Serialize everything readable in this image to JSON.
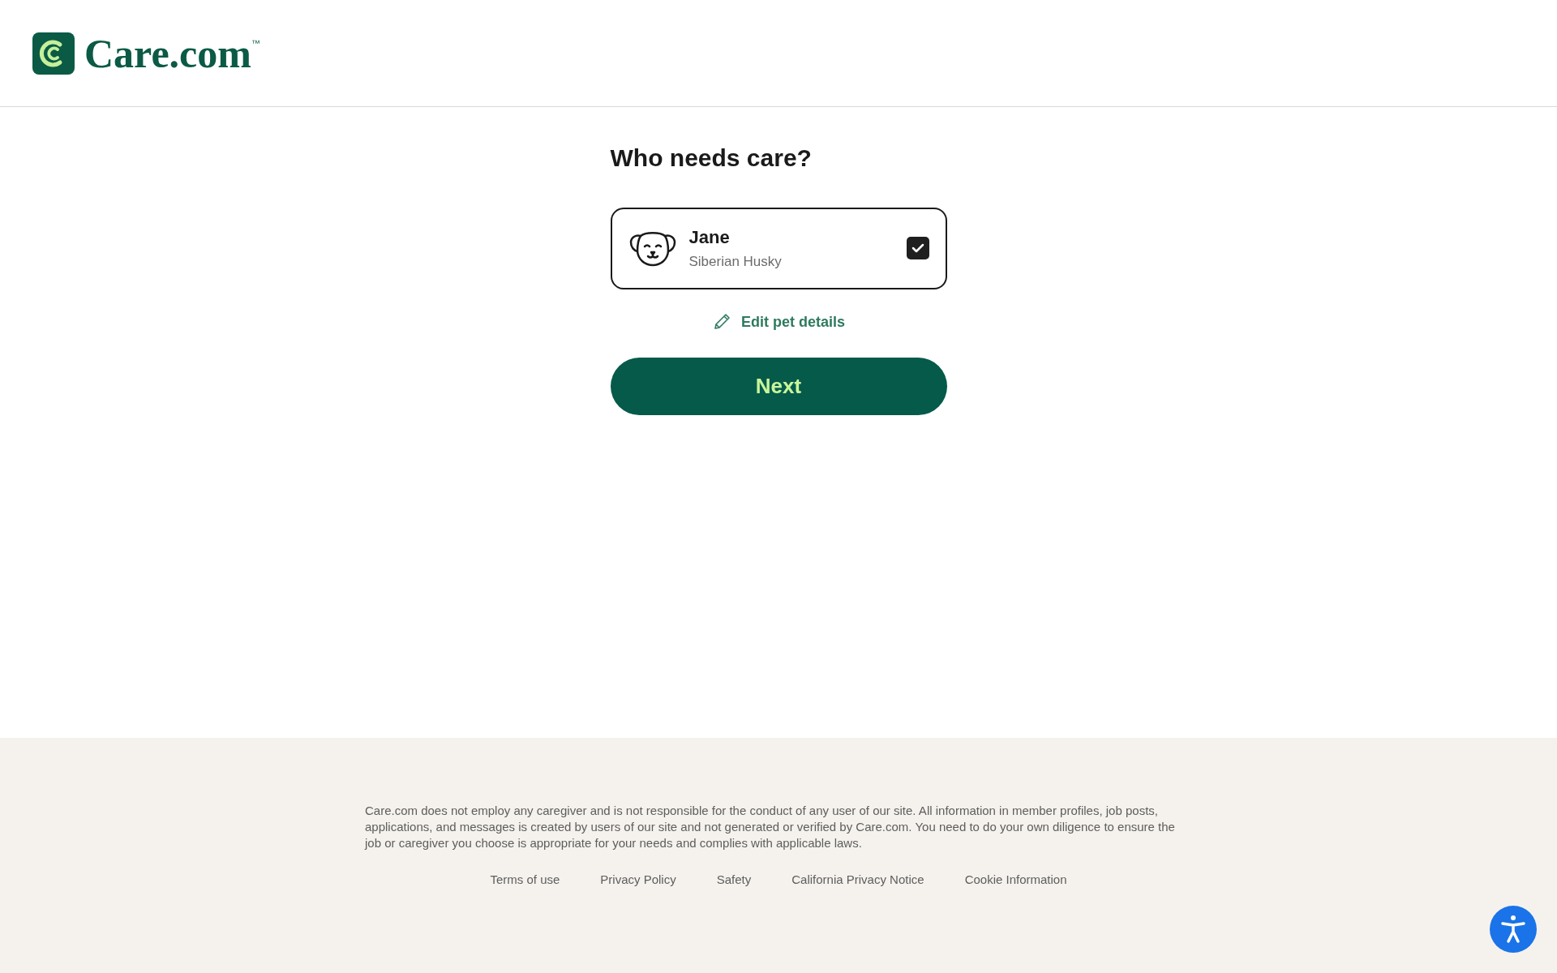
{
  "header": {
    "logo": {
      "name": "Care.com",
      "trademark": "™"
    }
  },
  "main": {
    "heading": "Who needs care?",
    "pets": [
      {
        "name": "Jane",
        "breed": "Siberian Husky",
        "checked": true
      }
    ],
    "edit_link": "Edit pet details",
    "next_button": "Next"
  },
  "footer": {
    "disclaimer": "Care.com does not employ any caregiver and is not responsible for the conduct of any user of our site. All information in member profiles, job posts, applications, and messages is created by users of our site and not generated or verified by Care.com. You need to do your own diligence to ensure the job or caregiver you choose is appropriate for your needs and complies with applicable laws.",
    "links": [
      "Terms of use",
      "Privacy Policy",
      "Safety",
      "California Privacy Notice",
      "Cookie Information"
    ]
  }
}
